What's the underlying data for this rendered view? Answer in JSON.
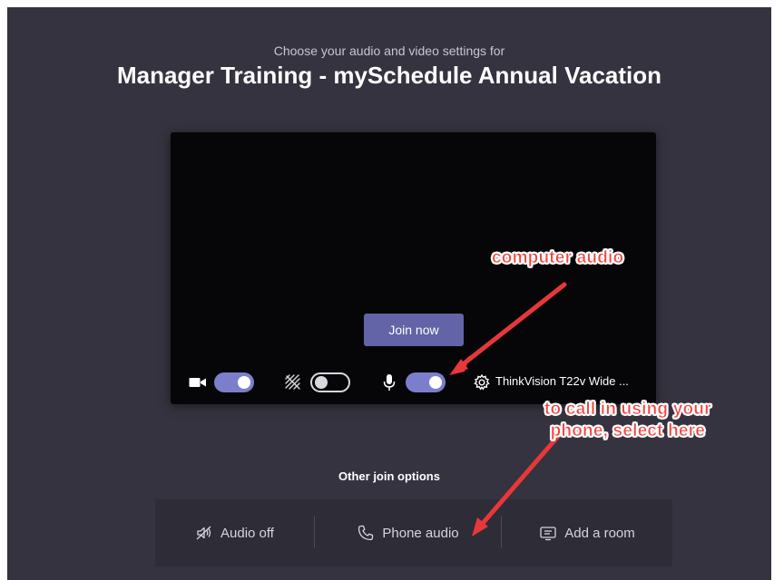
{
  "header": {
    "subtitle": "Choose your audio and video settings for",
    "meeting_title": "Manager Training - mySchedule Annual Vacation"
  },
  "preview": {
    "join_label": "Join now",
    "controls": {
      "camera": {
        "icon": "camera-icon",
        "state": "on"
      },
      "background_effects": {
        "icon": "background-blur-icon",
        "state": "off"
      },
      "microphone": {
        "icon": "microphone-icon",
        "state": "on"
      },
      "device_settings": {
        "icon": "gear-icon",
        "label": "ThinkVision T22v Wide ..."
      }
    }
  },
  "other_join": {
    "label": "Other join options",
    "options": [
      {
        "label": "Audio off",
        "icon": "speaker-off-icon"
      },
      {
        "label": "Phone audio",
        "icon": "phone-icon"
      },
      {
        "label": "Add a room",
        "icon": "cast-screen-icon"
      }
    ]
  },
  "annotations": {
    "computer_audio": "computer audio",
    "phone_line1": "to call in using your",
    "phone_line2": "phone, select here"
  },
  "colors": {
    "background": "#34333f",
    "accent": "#6264a7",
    "toggle_on": "#7b7fcb",
    "annotation": "#f0443f"
  }
}
